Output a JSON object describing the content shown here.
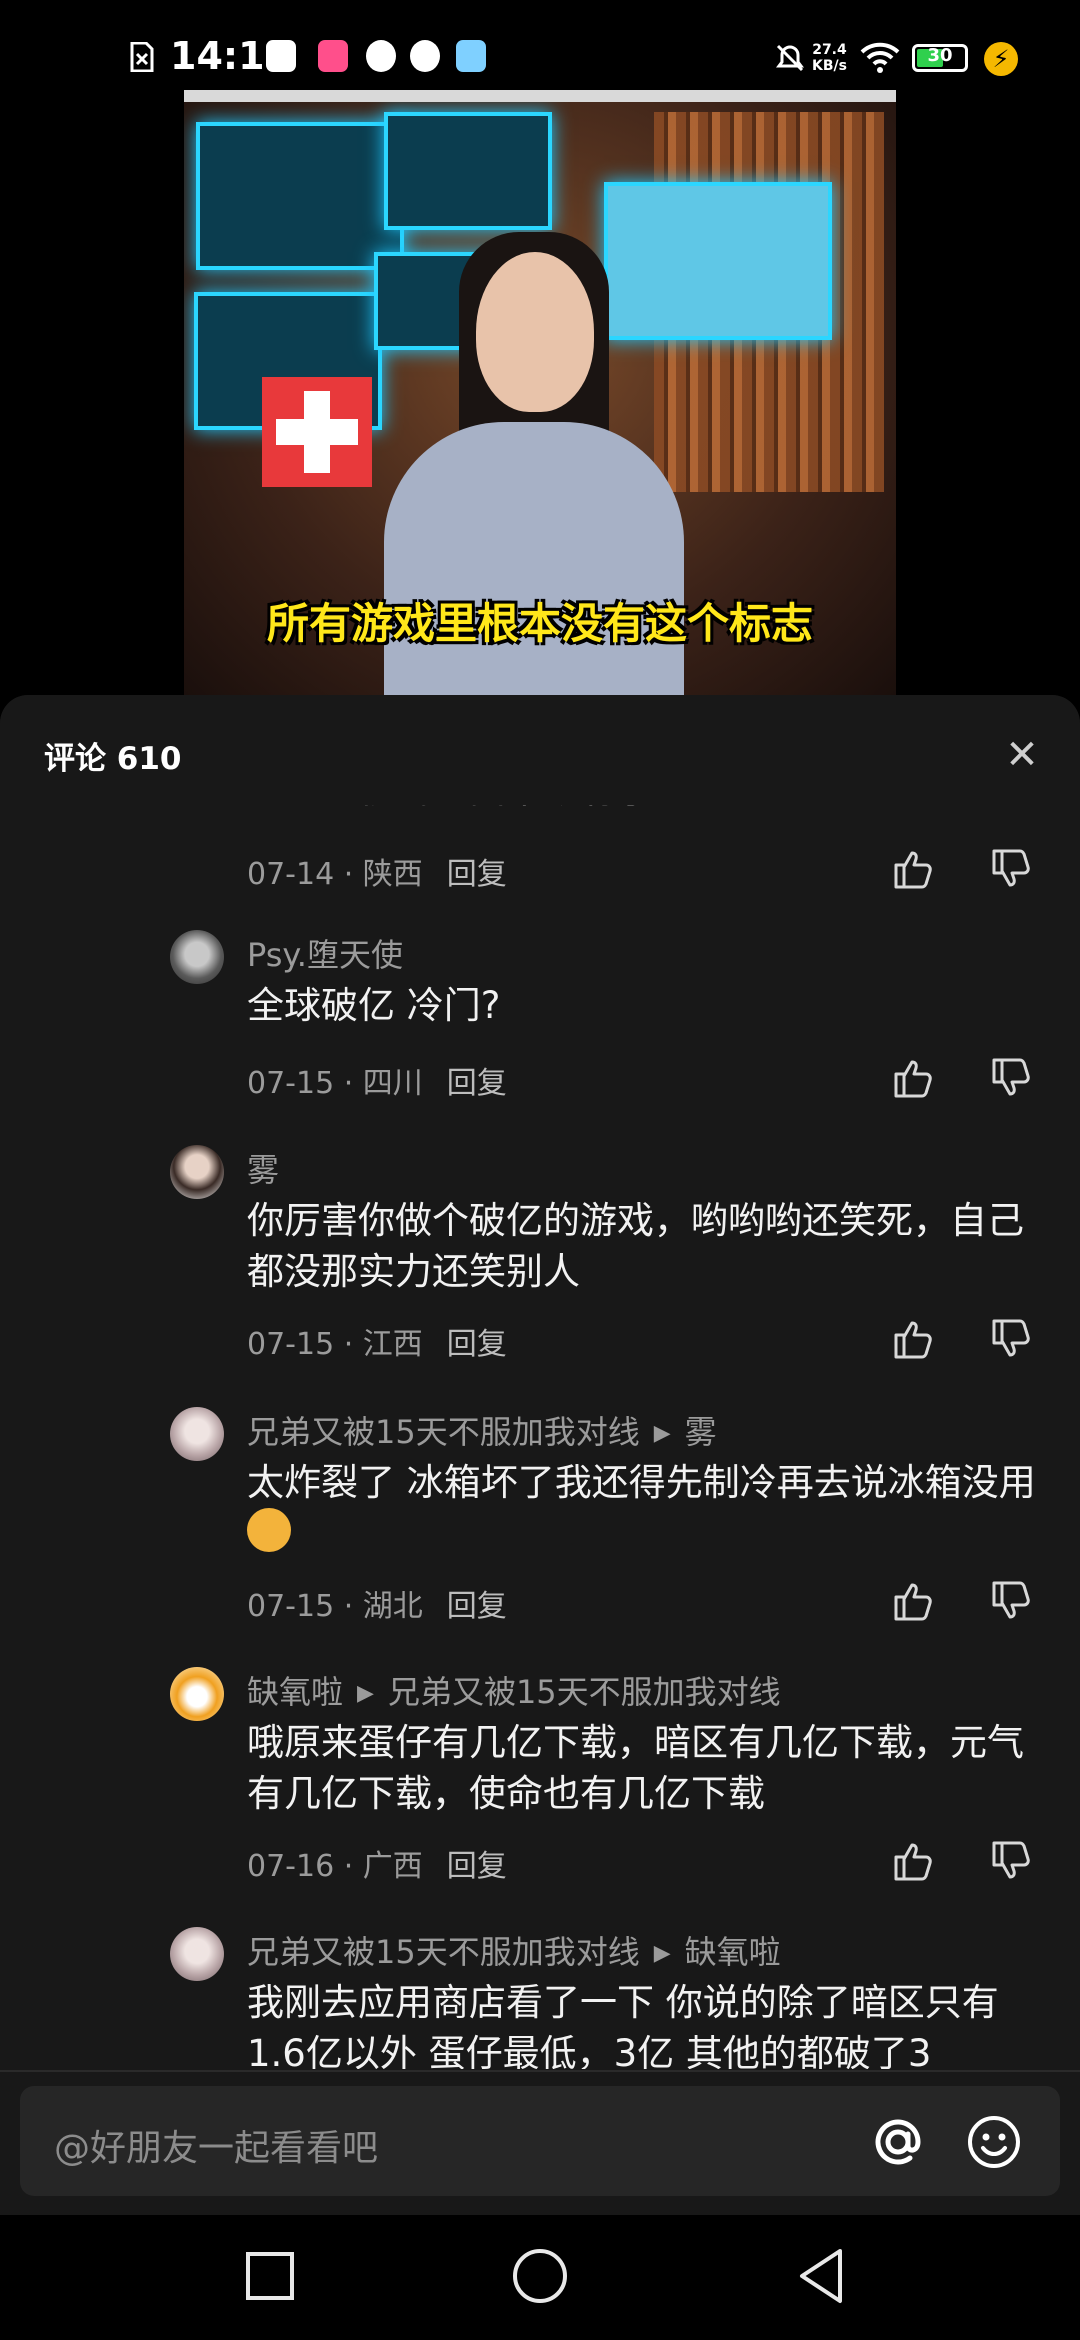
{
  "status_bar": {
    "time": "14:16",
    "net_speed_value": "27.4",
    "net_speed_unit": "KB/s",
    "battery_level": "30",
    "app_icons": [
      "file-icon",
      "tieba-icon",
      "lofter-icon",
      "video-app-icon",
      "link-app-icon",
      "bird-app-icon"
    ]
  },
  "video": {
    "caption": "所有游戏里根本没有这个标志"
  },
  "comments_panel": {
    "title": "评论 610",
    "partial_top_text": "这个电视剧全面早就有了",
    "top_meta": {
      "date": "07-14",
      "region": "陕西",
      "reply": "回复"
    },
    "items": [
      {
        "user": "Psy.堕天使",
        "reply_to": "",
        "text": "全球破亿 冷门?",
        "date": "07-15",
        "region": "四川",
        "reply": "回复"
      },
      {
        "user": "雾",
        "reply_to": "",
        "text": "你厉害你做个破亿的游戏，哟哟哟还笑死，自己都没那实力还笑别人",
        "date": "07-15",
        "region": "江西",
        "reply": "回复"
      },
      {
        "user": "兄弟又被15天不服加我对线",
        "reply_to": "雾",
        "text": "太炸裂了 冰箱坏了我还得先制冷再去说冰箱没用",
        "date": "07-15",
        "region": "湖北",
        "reply": "回复"
      },
      {
        "user": "缺氧啦",
        "reply_to": "兄弟又被15天不服加我对线",
        "text": "哦原来蛋仔有几亿下载，暗区有几亿下载，元气有几亿下载，使命也有几亿下载",
        "date": "07-16",
        "region": "广西",
        "reply": "回复"
      },
      {
        "user": "兄弟又被15天不服加我对线",
        "reply_to": "缺氧啦",
        "text": "我刚去应用商店看了一下 你说的除了暗区只有1.6亿以外 蛋仔最低，3亿 其他的都破了3",
        "date": "",
        "region": "",
        "reply": ""
      }
    ]
  },
  "input": {
    "placeholder": "@好朋友一起看看吧"
  },
  "colors": {
    "sheet_bg": "#181818",
    "secondary_text": "#9b9b9b",
    "caption_yellow": "#ffe71a"
  }
}
